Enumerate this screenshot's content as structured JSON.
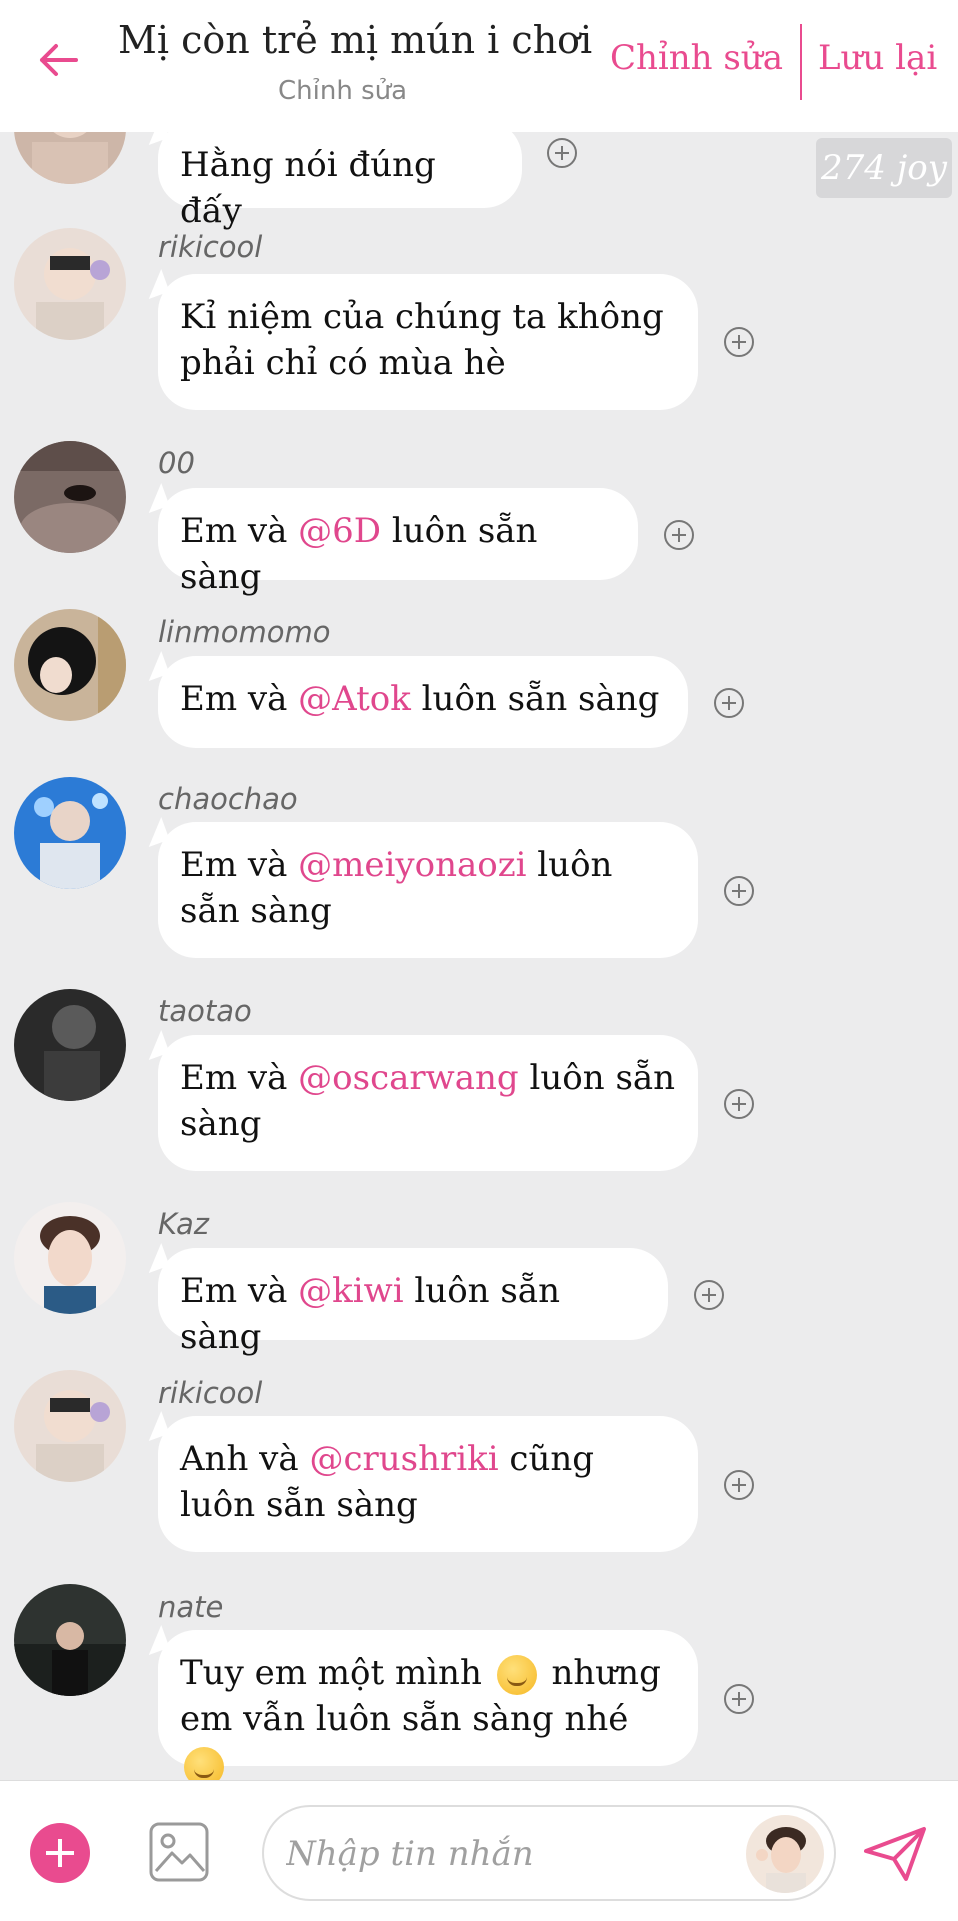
{
  "header": {
    "title": "Mị còn trẻ mị mún i chơi",
    "subtitle": "Chỉnh sửa",
    "edit_label": "Chỉnh sửa",
    "save_label": "Lưu lại"
  },
  "joy_badge": "274 joy",
  "messages": [
    {
      "username": "",
      "segments": [
        {
          "t": "Hằng nói đúng đấy"
        }
      ]
    },
    {
      "username": "rikicool",
      "segments": [
        {
          "t": "Kỉ niệm của chúng ta không phải chỉ có mùa hè"
        }
      ]
    },
    {
      "username": "00",
      "segments": [
        {
          "t": "Em và "
        },
        {
          "t": "@6D",
          "m": true
        },
        {
          "t": " luôn sẵn sàng"
        }
      ]
    },
    {
      "username": "linmomomo",
      "segments": [
        {
          "t": "Em và "
        },
        {
          "t": "@Atok",
          "m": true
        },
        {
          "t": "  luôn sẵn sàng"
        }
      ]
    },
    {
      "username": "chaochao",
      "segments": [
        {
          "t": "Em và "
        },
        {
          "t": "@meiyonaozi",
          "m": true
        },
        {
          "t": "  luôn sẵn sàng"
        }
      ]
    },
    {
      "username": "taotao",
      "segments": [
        {
          "t": "Em và "
        },
        {
          "t": "@oscarwang",
          "m": true
        },
        {
          "t": "  luôn sẵn sàng"
        }
      ]
    },
    {
      "username": "Kaz",
      "segments": [
        {
          "t": "Em và "
        },
        {
          "t": "@kiwi",
          "m": true
        },
        {
          "t": "  luôn sẵn sàng"
        }
      ]
    },
    {
      "username": "rikicool",
      "segments": [
        {
          "t": "Anh và "
        },
        {
          "t": "@crushriki",
          "m": true
        },
        {
          "t": " cũng luôn sẵn sàng"
        }
      ]
    },
    {
      "username": "nate",
      "segments": [
        {
          "t": "Tuy em một mình "
        },
        {
          "e": "pensive-emoji"
        },
        {
          "t": " nhưng em vẫn luôn sẵn sàng nhé "
        },
        {
          "e": "grinning-emoji"
        }
      ]
    }
  ],
  "composer": {
    "placeholder": "Nhập tin nhắn"
  },
  "colors": {
    "accent": "#e94b8f",
    "mention": "#e0478d",
    "background": "#ececed",
    "bubble": "#ffffff"
  },
  "icons": {
    "back": "arrow-left-icon",
    "plus": "plus-circle-icon",
    "image": "image-icon",
    "send": "send-icon"
  }
}
